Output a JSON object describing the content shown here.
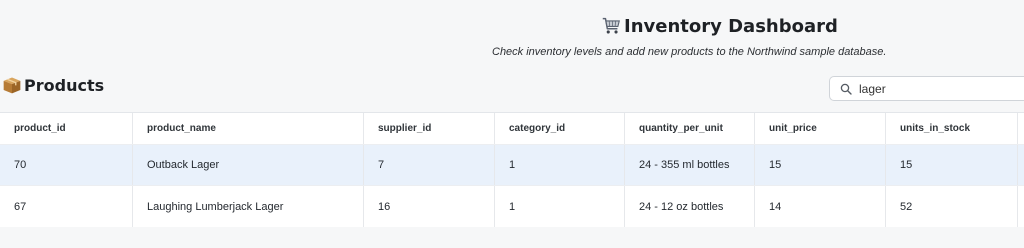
{
  "app": {
    "title": "Inventory Dashboard",
    "subtitle": "Check inventory levels and add new products to the Northwind sample database."
  },
  "section": {
    "title": "Products"
  },
  "search": {
    "value": "lager"
  },
  "table": {
    "columns": [
      "product_id",
      "product_name",
      "supplier_id",
      "category_id",
      "quantity_per_unit",
      "unit_price",
      "units_in_stock"
    ],
    "rows": [
      [
        "70",
        "Outback Lager",
        "7",
        "1",
        "24 - 355 ml bottles",
        "15",
        "15"
      ],
      [
        "67",
        "Laughing Lumberjack Lager",
        "16",
        "1",
        "24 - 12 oz bottles",
        "14",
        "52"
      ]
    ],
    "selected_row_color": "#e9f1fb"
  },
  "icons": {
    "title_icon": "shopping-cart-icon",
    "section_icon": "package-box-icon",
    "search_icon": "search-icon"
  }
}
